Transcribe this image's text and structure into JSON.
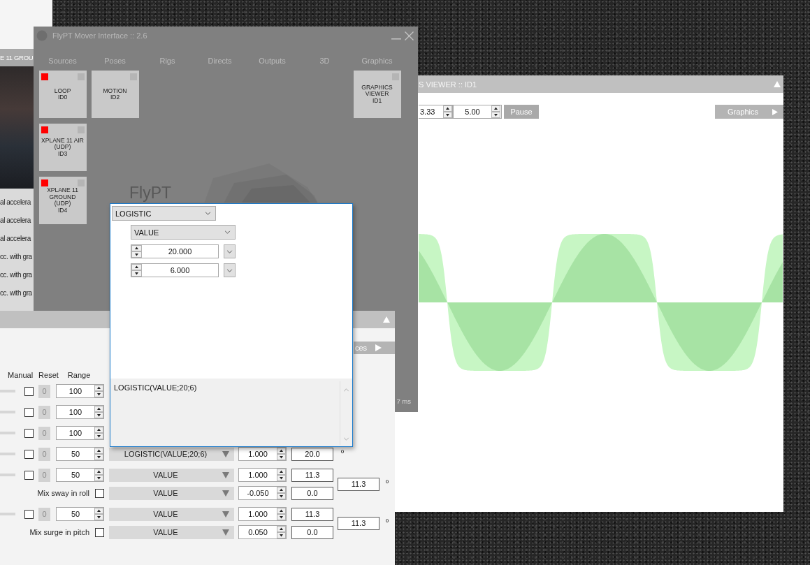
{
  "background_window": {
    "title": "E 11 GROU",
    "rows": [
      "al accelera",
      "al accelera",
      "al accelera",
      "cc. with gra",
      "cc. with gra",
      "cc. with gra"
    ]
  },
  "main_window": {
    "title": "FlyPT Mover Interface :: 2.6",
    "columns": [
      {
        "tab": "Sources",
        "modules": [
          {
            "lines": [
              "LOOP",
              "ID0"
            ],
            "active": true
          },
          {
            "lines": [
              "XPLANE 11 AIR",
              "(UDP)",
              "ID3"
            ],
            "active": true
          },
          {
            "lines": [
              "XPLANE 11",
              "GROUND",
              "(UDP)",
              "ID4"
            ],
            "active": true
          }
        ]
      },
      {
        "tab": "Poses",
        "modules": [
          {
            "lines": [
              "MOTION",
              "ID2"
            ],
            "active": false
          }
        ]
      },
      {
        "tab": "Rigs"
      },
      {
        "tab": "Directs"
      },
      {
        "tab": "Outputs"
      },
      {
        "tab": "3D"
      },
      {
        "tab": "Graphics",
        "modules": [
          {
            "lines": [
              "GRAPHICS",
              "VIEWER",
              "ID1"
            ],
            "active": false
          }
        ]
      }
    ],
    "logo": "FlyPT",
    "status": "7 ms"
  },
  "graphics_window": {
    "title": "S VIEWER :: ID1",
    "fields": [
      "3.33",
      "5.00"
    ],
    "pause_button": "Pause",
    "menu_button": "Graphics"
  },
  "channel_window": {
    "section_button": "ces",
    "headers": [
      "Manual",
      "Reset",
      "Range"
    ],
    "groups": [
      {
        "rows": [
          {
            "kind": "axis",
            "manual": false,
            "reset": "0",
            "range": "100"
          }
        ]
      },
      {
        "rows": [
          {
            "kind": "axis",
            "manual": false,
            "reset": "0",
            "range": "100"
          }
        ]
      },
      {
        "rows": [
          {
            "kind": "axis",
            "manual": false,
            "reset": "0",
            "range": "100"
          }
        ]
      },
      {
        "rows": [
          {
            "kind": "axis",
            "manual": false,
            "reset": "0",
            "range": "50",
            "function": "LOGISTIC(VALUE;20;6)",
            "gain": "1.000",
            "output": "20.0"
          }
        ],
        "unit": "º"
      },
      {
        "rows": [
          {
            "kind": "axis",
            "manual": false,
            "reset": "0",
            "range": "50",
            "function": "VALUE",
            "gain": "1.000",
            "output": "11.3"
          },
          {
            "kind": "mix",
            "label": "Mix sway in roll",
            "checked": false,
            "function": "VALUE",
            "gain": "-0.050",
            "output": "0.0"
          }
        ],
        "total": "11.3",
        "unit": "º"
      },
      {
        "rows": [
          {
            "kind": "axis",
            "manual": false,
            "reset": "0",
            "range": "50",
            "function": "VALUE",
            "gain": "1.000",
            "output": "11.3"
          },
          {
            "kind": "mix",
            "label": "Mix surge in pitch",
            "checked": false,
            "function": "VALUE",
            "gain": "0.050",
            "output": "0.0"
          }
        ],
        "total": "11.3",
        "unit": "º"
      }
    ]
  },
  "function_editor": {
    "function": "LOGISTIC",
    "argument": "VALUE",
    "parameters": [
      "20.000",
      "6.000"
    ],
    "expression": "LOGISTIC(VALUE;20;6)"
  }
}
